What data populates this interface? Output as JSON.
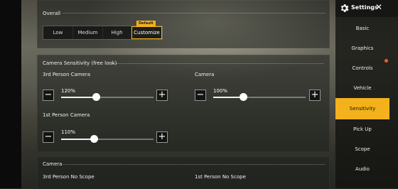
{
  "header": {
    "title": "Settings",
    "close_label": "✕"
  },
  "overall": {
    "label": "Overall",
    "options": [
      {
        "label": "Low",
        "selected": false
      },
      {
        "label": "Medium",
        "selected": false
      },
      {
        "label": "High",
        "selected": false
      },
      {
        "label": "Customize",
        "selected": true
      }
    ],
    "default_tag": "Default"
  },
  "camera_sensitivity": {
    "label": "Camera Sensitivity (free look)",
    "third_person": {
      "label": "3rd Person Camera",
      "value": "120%",
      "fraction": 0.38
    },
    "camera": {
      "label": "Camera",
      "value": "100%",
      "fraction": 0.32
    },
    "first_person": {
      "label": "1st Person Camera",
      "value": "110%",
      "fraction": 0.35
    }
  },
  "camera_section": {
    "label": "Camera",
    "third_no_scope": "3rd Person No Scope",
    "first_no_scope": "1st Person No Scope"
  },
  "sidebar": {
    "items": [
      {
        "label": "Basic",
        "active": false,
        "notify": false
      },
      {
        "label": "Graphics",
        "active": false,
        "notify": false
      },
      {
        "label": "Controls",
        "active": false,
        "notify": true
      },
      {
        "label": "Vehicle",
        "active": false,
        "notify": false
      },
      {
        "label": "Sensitivity",
        "active": true,
        "notify": false
      },
      {
        "label": "Pick Up",
        "active": false,
        "notify": false
      },
      {
        "label": "Scope",
        "active": false,
        "notify": false
      },
      {
        "label": "Audio",
        "active": false,
        "notify": false
      }
    ]
  },
  "colors": {
    "accent": "#f3b21b",
    "notify": "#ff5a1e"
  }
}
